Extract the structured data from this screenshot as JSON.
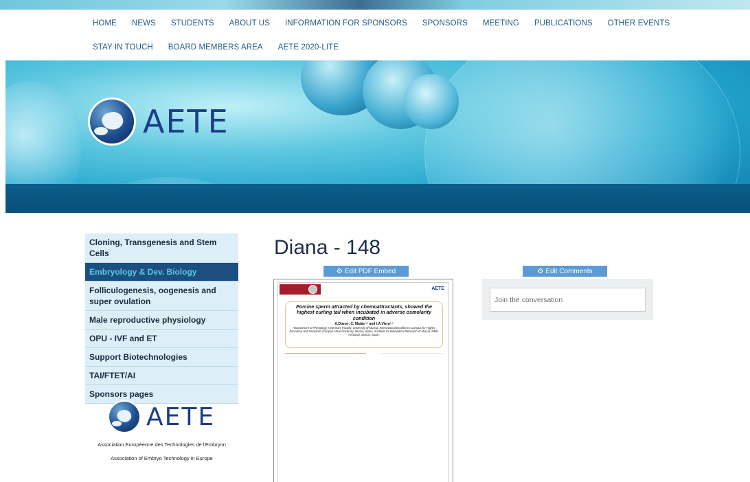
{
  "nav": {
    "row1": [
      "HOME",
      "NEWS",
      "STUDENTS",
      "ABOUT US",
      "INFORMATION FOR SPONSORS",
      "SPONSORS",
      "MEETING",
      "PUBLICATIONS",
      "OTHER EVENTS"
    ],
    "row2": [
      "STAY IN TOUCH",
      "BOARD MEMBERS AREA",
      "AETE 2020-LITE"
    ]
  },
  "banner": {
    "logo_text": "AETE"
  },
  "sidebar": {
    "items": [
      {
        "label": "Cloning, Transgenesis and Stem Cells",
        "active": false
      },
      {
        "label": "Embryology & Dev. Biology",
        "active": true
      },
      {
        "label": "Folliculogenesis, oogenesis and super ovulation",
        "active": false
      },
      {
        "label": "Male reproductive physiology",
        "active": false
      },
      {
        "label": "OPU - IVF and ET",
        "active": false
      },
      {
        "label": "Support Biotechnologies",
        "active": false
      },
      {
        "label": "TAI/FTET/AI",
        "active": false
      },
      {
        "label": "Sponsors pages",
        "active": false
      }
    ],
    "logo_text": "AETE",
    "caption_line1": "Association Européenne des Technologies de l'Embryon",
    "caption_line2": "Association of Embryo Technology in Europe"
  },
  "main": {
    "page_title": "Diana - 148",
    "edit_pdf_label": "Edit PDF Embed",
    "edit_comments_label": "Edit Comments",
    "pdf": {
      "logo_text": "AETE",
      "title": "Porcine sperm attracted by chemoattractants, showed the highest curling tail when incubated in adverse osmolarity condition",
      "authors": "A.Diana¹, C. Matás¹·² and I.A.Viera¹·²",
      "affiliation": "¹Department of Physiology, Veterinary Faculty, University of Murcia, International Excellence Campus for Higher Education and Research (Campus Mare Nostrum), Murcia, Spain. ²Institute for Biomedical Research of Murcia (IMIB-Arrixaca), Murcia, Spain."
    },
    "comments": {
      "placeholder": "Join the conversation"
    }
  },
  "colors": {
    "nav_text": "#1e5d87",
    "sidebar_bg": "#dceff9",
    "sidebar_active_bg": "#1b4f7e",
    "sidebar_active_text": "#5cc5e6",
    "edit_button": "#5b9bd5",
    "logo": "#1b3f86"
  }
}
